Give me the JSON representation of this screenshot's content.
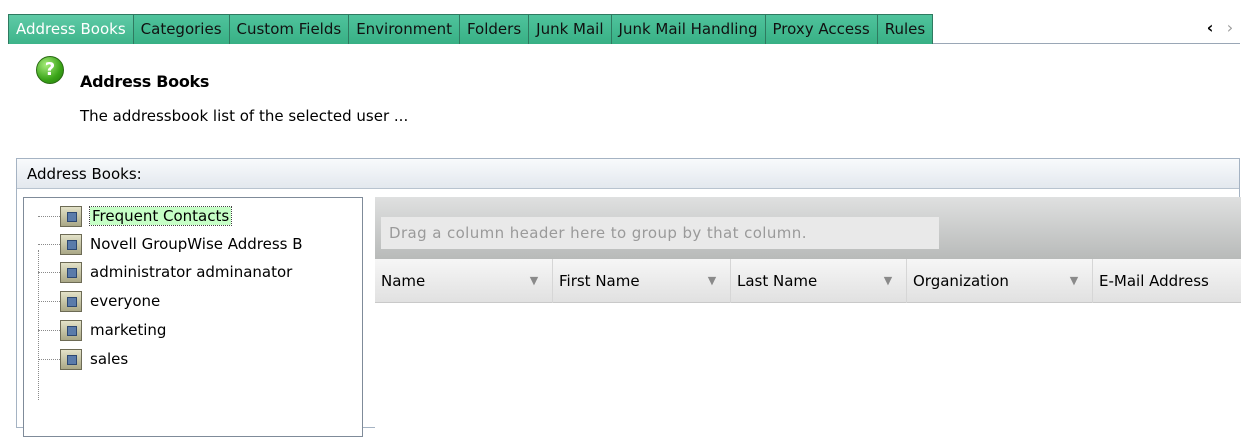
{
  "tabs": [
    {
      "label": "Address Books",
      "active": true
    },
    {
      "label": "Categories"
    },
    {
      "label": "Custom Fields"
    },
    {
      "label": "Environment"
    },
    {
      "label": "Folders"
    },
    {
      "label": "Junk Mail"
    },
    {
      "label": "Junk Mail Handling"
    },
    {
      "label": "Proxy Access"
    },
    {
      "label": "Rules"
    }
  ],
  "tab_nav": {
    "prev": "‹",
    "next": "›"
  },
  "header": {
    "icon": "help-icon",
    "title": "Address Books",
    "description": "The addressbook list of the selected user ..."
  },
  "group": {
    "label": "Address Books:",
    "tree": [
      {
        "label": "Frequent Contacts",
        "selected": true
      },
      {
        "label": "Novell GroupWise Address B"
      },
      {
        "label": "administrator adminanator"
      },
      {
        "label": "everyone"
      },
      {
        "label": "marketing"
      },
      {
        "label": "sales"
      }
    ],
    "grid": {
      "group_hint": "Drag a column header here to group by that column.",
      "columns": [
        "Name",
        "First Name",
        "Last Name",
        "Organization",
        "E-Mail Address"
      ]
    }
  },
  "colors": {
    "tab_green": "#3db48a",
    "selection": "#c6ffc6",
    "panel_border": "#a5b3c3"
  }
}
